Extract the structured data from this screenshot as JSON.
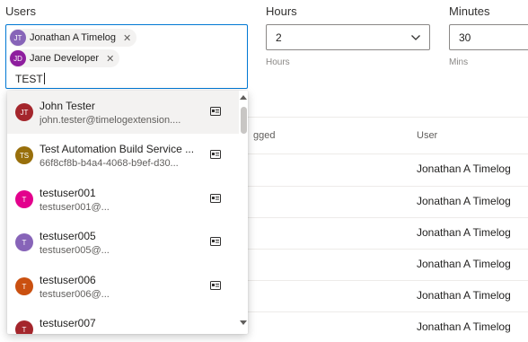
{
  "users": {
    "label": "Users",
    "chips": [
      {
        "initials": "JT",
        "name": "Jonathan A Timelog",
        "color": "#8764b8"
      },
      {
        "initials": "JD",
        "name": "Jane Developer",
        "color": "#8e1e9e"
      }
    ],
    "remove_glyph": "✕",
    "query": "TEST"
  },
  "hours": {
    "label": "Hours",
    "value": "2",
    "hint": "Hours"
  },
  "minutes": {
    "label": "Minutes",
    "value": "30",
    "hint": "Mins"
  },
  "table": {
    "col_logged": "gged",
    "col_user": "User",
    "rows": [
      "Jonathan A Timelog",
      "Jonathan A Timelog",
      "Jonathan A Timelog",
      "Jonathan A Timelog",
      "Jonathan A Timelog",
      "Jonathan A Timelog"
    ]
  },
  "suggestions": [
    {
      "initials": "JT",
      "name": "John Tester",
      "secondary": "john.tester@timelogextension....",
      "color": "#a4262c"
    },
    {
      "initials": "TS",
      "name": "Test Automation Build Service ...",
      "secondary": "66f8cf8b-b4a4-4068-b9ef-d30...",
      "color": "#986f0b"
    },
    {
      "initials": "T",
      "name": "testuser001",
      "secondary": "testuser001@...",
      "color": "#e3008c"
    },
    {
      "initials": "T",
      "name": "testuser005",
      "secondary": "testuser005@...",
      "color": "#8764b8"
    },
    {
      "initials": "T",
      "name": "testuser006",
      "secondary": "testuser006@...",
      "color": "#ca5010"
    },
    {
      "initials": "T",
      "name": "testuser007",
      "secondary": "",
      "color": "#a4262c"
    }
  ],
  "icons": {
    "contact_card": "contact-card-icon",
    "chevron": "chevron-down-icon",
    "remove": "close-icon"
  }
}
